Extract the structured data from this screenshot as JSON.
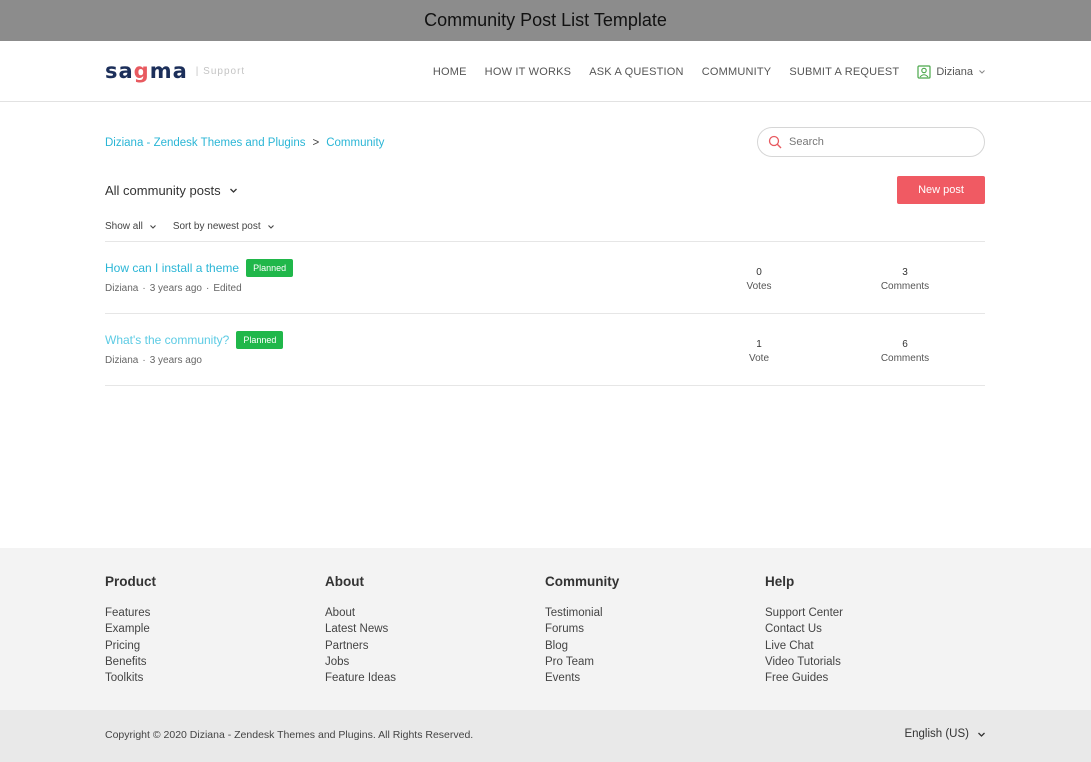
{
  "page_title": "Community Post List Template",
  "logo": {
    "text_before": "sa",
    "text_o": "g",
    "text_after": "ma",
    "subtitle": "| Support"
  },
  "nav": {
    "items": [
      "HOME",
      "HOW IT WORKS",
      "ASK A QUESTION",
      "COMMUNITY",
      "SUBMIT A REQUEST"
    ],
    "user_name": "Diziana"
  },
  "breadcrumb": {
    "items": [
      "Diziana - Zendesk Themes and Plugins",
      "Community"
    ],
    "separator": ">"
  },
  "search": {
    "placeholder": "Search",
    "value": ""
  },
  "filter": {
    "label": "All community posts"
  },
  "new_post_label": "New post",
  "sort": {
    "show": "Show all",
    "order": "Sort by newest post"
  },
  "posts": [
    {
      "title": "How can I install a theme",
      "badge": "Planned",
      "author": "Diziana",
      "time": "3 years ago",
      "edited": "Edited",
      "votes": "0",
      "votes_label": "Votes",
      "comments": "3",
      "comments_label": "Comments"
    },
    {
      "title": "What's the community?",
      "badge": "Planned",
      "author": "Diziana",
      "time": "3 years ago",
      "edited": "",
      "votes": "1",
      "votes_label": "Vote",
      "comments": "6",
      "comments_label": "Comments"
    }
  ],
  "footer": {
    "columns": [
      {
        "heading": "Product",
        "links": [
          "Features",
          "Example",
          "Pricing",
          "Benefits",
          "Toolkits"
        ]
      },
      {
        "heading": "About",
        "links": [
          "About",
          "Latest News",
          "Partners",
          "Jobs",
          "Feature Ideas"
        ]
      },
      {
        "heading": "Community",
        "links": [
          "Testimonial",
          "Forums",
          "Blog",
          "Pro Team",
          "Events"
        ]
      },
      {
        "heading": "Help",
        "links": [
          "Support Center",
          "Contact Us",
          "Live Chat",
          "Video Tutorials",
          "Free Guides"
        ]
      }
    ],
    "copyright": "Copyright © 2020 Diziana - Zendesk Themes and Plugins. All Rights Reserved.",
    "language": "English (US)"
  },
  "colors": {
    "accent": "#2bb6d6",
    "button": "#f05a63",
    "badge": "#20b74a",
    "brand": "#1c2f5a"
  }
}
